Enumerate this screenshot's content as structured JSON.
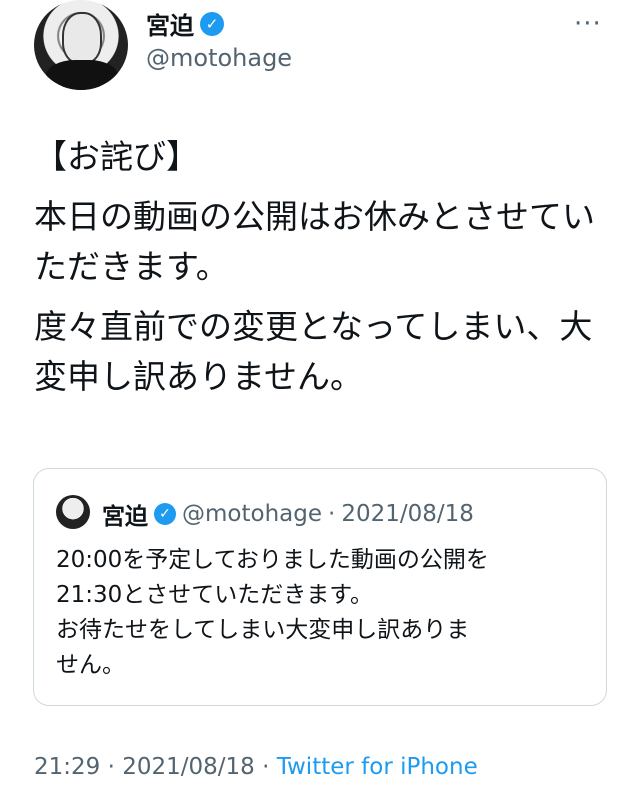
{
  "author": {
    "display_name": "宮迫",
    "handle": "@motohage",
    "verified_icon": "✓"
  },
  "menu": {
    "more_icon": "···"
  },
  "tweet": {
    "paragraphs": [
      "【お詫び】",
      "本日の動画の公開はお休みとさせていただきます。",
      "度々直前での変更となってしまい、大変申し訳ありません。"
    ]
  },
  "quote": {
    "display_name": "宮迫",
    "verified_icon": "✓",
    "handle": "@motohage",
    "separator": "·",
    "date": "2021/08/18",
    "lines": [
      "20:00を予定しておりました動画の公開を",
      "21:30とさせていただきます。",
      "お待たせをしてしまい大変申し訳ありま",
      "せん。"
    ]
  },
  "footer": {
    "time": "21:29",
    "separator": "·",
    "date": "2021/08/18",
    "source": "Twitter for iPhone"
  },
  "colors": {
    "accent": "#1d9bf0",
    "secondary_text": "#536471",
    "border": "#cfd9de"
  }
}
